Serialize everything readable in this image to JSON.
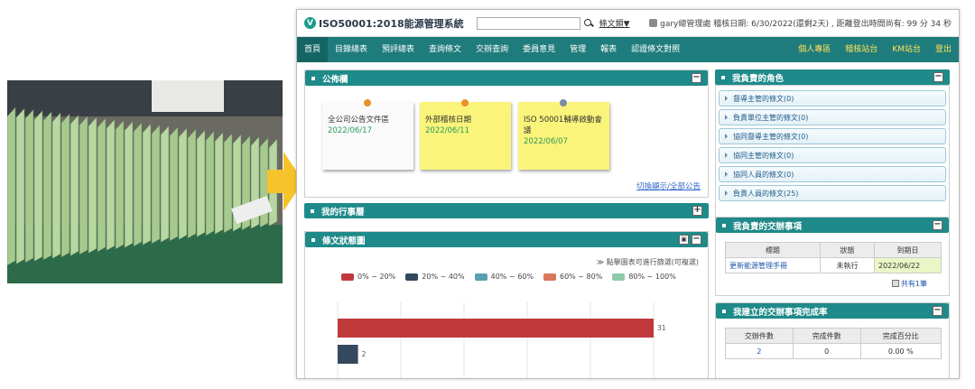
{
  "app": {
    "title": "ISO50001:2018能源管理系統",
    "logo_letter": "V",
    "search_placeholder": "",
    "doc_type": "條文類▼",
    "user_info": "gary總管理處 稽核日期: 6/30/2022(還剩2天) , 距離登出時間尚有: 99 分 34 秒"
  },
  "nav": {
    "items": [
      "首頁",
      "目錄總表",
      "預評總表",
      "查詢條文",
      "交辦查詢",
      "委員意見",
      "管理",
      "報表",
      "認證條文對照"
    ],
    "right": [
      "個人專區",
      "稽核站台",
      "KM站台",
      "登出"
    ]
  },
  "notice": {
    "title": "公佈欄",
    "notes": [
      {
        "title": "全公司公告文件區",
        "date": "2022/06/17"
      },
      {
        "title": "外部稽核日期",
        "date": "2022/06/11"
      },
      {
        "title": "ISO 50001輔導啟動會議",
        "date": "2022/06/07"
      }
    ],
    "more": "切換顯示/全部公告"
  },
  "schedule": {
    "title": "我的行事曆"
  },
  "status": {
    "title": "條文狀態圖",
    "hint": "點擊圖表可進行篩選(可複選)"
  },
  "chart_data": {
    "type": "bar",
    "orientation": "horizontal",
    "series": [
      {
        "name": "0% ~ 20%",
        "color": "#c0393b",
        "values": [
          31
        ]
      },
      {
        "name": "20% ~ 40%",
        "color": "#34495e",
        "values": [
          2
        ]
      },
      {
        "name": "40% ~ 60%",
        "color": "#5ba0b0",
        "values": []
      },
      {
        "name": "60% ~ 80%",
        "color": "#d9775a",
        "values": []
      },
      {
        "name": "80% ~ 100%",
        "color": "#8fc9a8",
        "values": []
      }
    ],
    "xlim": [
      0,
      31
    ],
    "grid": true,
    "legend": "top"
  },
  "roles": {
    "title": "我負責的角色",
    "items": [
      "督導主管的條文(0)",
      "負責單位主管的條文(0)",
      "協同督導主管的條文(0)",
      "協同主管的條文(0)",
      "協同人員的條文(0)",
      "負責人員的條文(25)"
    ]
  },
  "tasks": {
    "title": "我負責的交辦事項",
    "headers": [
      "標題",
      "狀態",
      "到期日"
    ],
    "rows": [
      [
        "更新能源管理手冊",
        "未執行",
        "2022/06/22"
      ]
    ],
    "total": "共有1筆"
  },
  "rate": {
    "title": "我建立的交辦事項完成率",
    "headers": [
      "交辦件數",
      "完成件數",
      "完成百分比"
    ],
    "values": [
      "2",
      "0",
      "0.00 %"
    ]
  },
  "colors": {
    "nav": "#1f7c7c",
    "panel_header": "#1f8a8a",
    "sticky_note": "#fbf47a",
    "arrow": "#f6c32a"
  }
}
